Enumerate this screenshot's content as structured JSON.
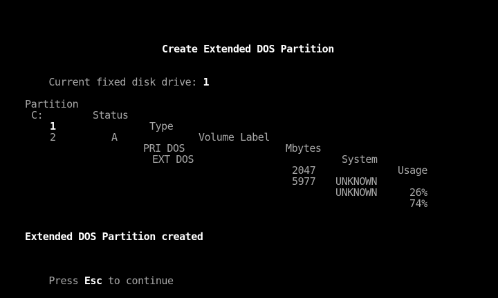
{
  "title": "Create Extended DOS Partition",
  "drive": {
    "label": "Current fixed disk drive:",
    "value": "1"
  },
  "table": {
    "headers": {
      "partition": "Partition",
      "status": "Status",
      "type": "Type",
      "volume_label": "Volume Label",
      "mbytes": "Mbytes",
      "system": "System",
      "usage": "Usage"
    },
    "rows": [
      {
        "drive_letter": "C:",
        "partition": "1",
        "status": "A",
        "type": "PRI DOS",
        "volume_label": "",
        "mbytes": "2047",
        "system": "UNKNOWN",
        "usage": "26%"
      },
      {
        "drive_letter": "",
        "partition": "2",
        "status": "",
        "type": "EXT DOS",
        "volume_label": "",
        "mbytes": "5977",
        "system": "UNKNOWN",
        "usage": "74%"
      }
    ]
  },
  "message": "Extended DOS Partition created",
  "prompt": {
    "prefix": "Press",
    "key": "Esc",
    "suffix": "to continue"
  },
  "colors": {
    "background": "#000000",
    "normal_text": "#a8a8a8",
    "bright_text": "#ffffff"
  }
}
